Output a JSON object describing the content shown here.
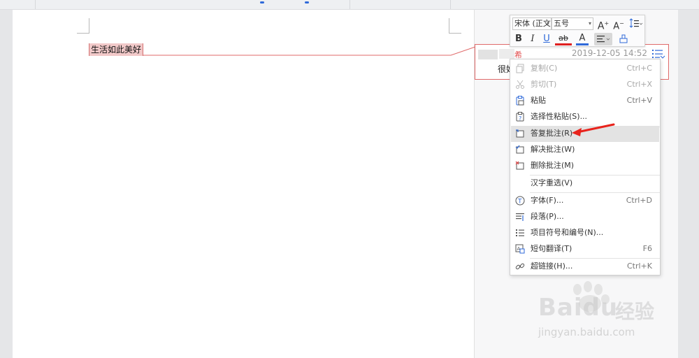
{
  "document": {
    "selected_text": "生活如此美好"
  },
  "comment": {
    "author_tail": "希",
    "date": "2019-12-05 14:52",
    "body": "很好"
  },
  "mini_toolbar": {
    "font_name": "宋体 (正文",
    "font_size": "五号",
    "bold": "B",
    "italic": "I",
    "underline": "U",
    "strike": "ab",
    "font_color": "A"
  },
  "context_menu": {
    "items": [
      {
        "label": "复制(C)",
        "shortcut": "Ctrl+C",
        "icon": "copy-icon",
        "enabled": false
      },
      {
        "label": "剪切(T)",
        "shortcut": "Ctrl+X",
        "icon": "scissors-icon",
        "enabled": false
      },
      {
        "label": "粘贴",
        "shortcut": "Ctrl+V",
        "icon": "paste-icon",
        "enabled": true
      },
      {
        "label": "选择性粘贴(S)...",
        "shortcut": "",
        "icon": "paste-special-icon",
        "enabled": true
      },
      {
        "label": "答复批注(R)",
        "shortcut": "",
        "icon": "reply-comment-icon",
        "enabled": true,
        "highlighted": true
      },
      {
        "label": "解决批注(W)",
        "shortcut": "",
        "icon": "resolve-comment-icon",
        "enabled": true
      },
      {
        "label": "删除批注(M)",
        "shortcut": "",
        "icon": "delete-comment-icon",
        "enabled": true
      },
      {
        "label": "汉字重选(V)",
        "shortcut": "",
        "icon": "",
        "enabled": true
      },
      {
        "label": "字体(F)...",
        "shortcut": "Ctrl+D",
        "icon": "font-icon",
        "enabled": true
      },
      {
        "label": "段落(P)...",
        "shortcut": "",
        "icon": "paragraph-icon",
        "enabled": true
      },
      {
        "label": "项目符号和编号(N)...",
        "shortcut": "",
        "icon": "bullet-list-icon",
        "enabled": true
      },
      {
        "label": "短句翻译(T)",
        "shortcut": "F6",
        "icon": "translate-icon",
        "enabled": true
      },
      {
        "label": "超链接(H)...",
        "shortcut": "Ctrl+K",
        "icon": "hyperlink-icon",
        "enabled": true
      }
    ]
  },
  "watermark": {
    "brand": "Bai",
    "brand2": "du",
    "cn": "经验",
    "url": "jingyan.baidu.com"
  },
  "colors": {
    "selection_fill": "#f2c9c9",
    "comment_border": "#e06a6a",
    "arrow": "#e8231c",
    "highlight_row": "#e3e3e3"
  }
}
